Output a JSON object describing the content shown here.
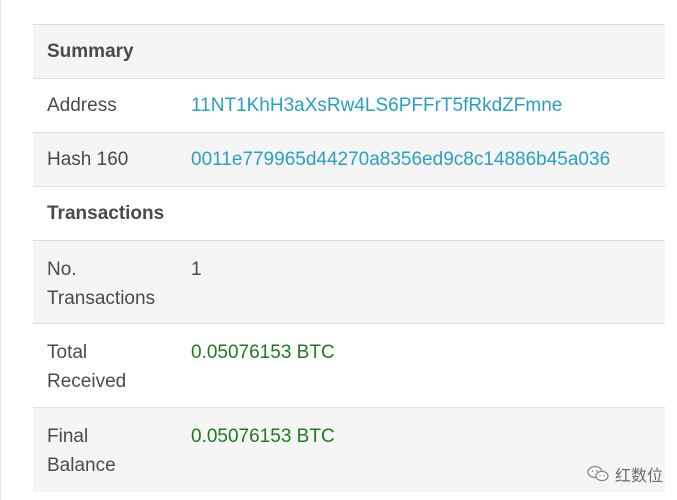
{
  "summary": {
    "title": "Summary"
  },
  "address": {
    "label": "Address",
    "value": "11NT1KhH3aXsRw4LS6PFFrT5fRkdZFmne"
  },
  "hash160": {
    "label": "Hash 160",
    "value": "0011e779965d44270a8356ed9c8c14886b45a036"
  },
  "transactions": {
    "title": "Transactions"
  },
  "no_transactions": {
    "label_line1": "No.",
    "label_line2": "Transactions",
    "value": "1"
  },
  "total_received": {
    "label_line1": "Total",
    "label_line2": "Received",
    "value": "0.05076153 BTC"
  },
  "final_balance": {
    "label_line1": "Final",
    "label_line2": "Balance",
    "value": "0.05076153 BTC"
  },
  "watermark": {
    "icon": "wechat-icon",
    "text": "红数位"
  },
  "colors": {
    "link": "#2a9fc4",
    "amount": "#1f7a1f",
    "row_alt": "#f5f5f5"
  }
}
